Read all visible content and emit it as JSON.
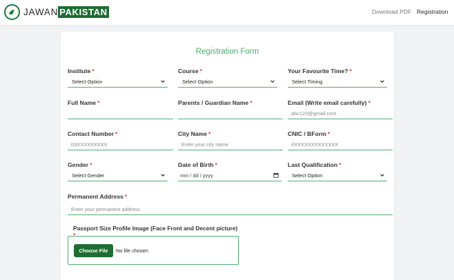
{
  "brand": {
    "part1": "JAWAN",
    "part2": "PAKISTAN",
    "logo_icon": "bird-icon"
  },
  "nav": {
    "download": "Download PDF",
    "registration": "Registration"
  },
  "form": {
    "title": "Registration Form",
    "required_mark": "*",
    "institute": {
      "label": "Institute",
      "value": "Select Option"
    },
    "course": {
      "label": "Course",
      "value": "Select Option"
    },
    "timing": {
      "label": "Your Favourite Time?",
      "value": "Select Timing"
    },
    "full_name": {
      "label": "Full Name",
      "value": ""
    },
    "guardian": {
      "label": "Parents / Guardian Name",
      "value": ""
    },
    "email": {
      "label": "Email (Write email carefully)",
      "placeholder": "abc123@gmail.com"
    },
    "contact": {
      "label": "Contact Number",
      "placeholder": "03XXXXXXXXX"
    },
    "city": {
      "label": "City Name",
      "placeholder": "Enter your city name"
    },
    "cnic": {
      "label": "CNIC / BForm",
      "placeholder": "4XXXXXXXXXXXXX"
    },
    "gender": {
      "label": "Gender",
      "value": "Select Gender"
    },
    "dob": {
      "label": "Date of Birth",
      "placeholder": "mm / dd / yyyy"
    },
    "qualification": {
      "label": "Last Qualification",
      "value": "Select Option"
    },
    "address": {
      "label": "Permanent Address",
      "placeholder": "Enter your permanent address"
    },
    "upload": {
      "label": "Passport Size Profile Image (Face Front and Decent picture)",
      "button": "Choose File",
      "status": "No file chosen"
    }
  },
  "colors": {
    "accent": "#4caf6a",
    "brand_dark": "#1e6b34",
    "required": "#e53935"
  }
}
